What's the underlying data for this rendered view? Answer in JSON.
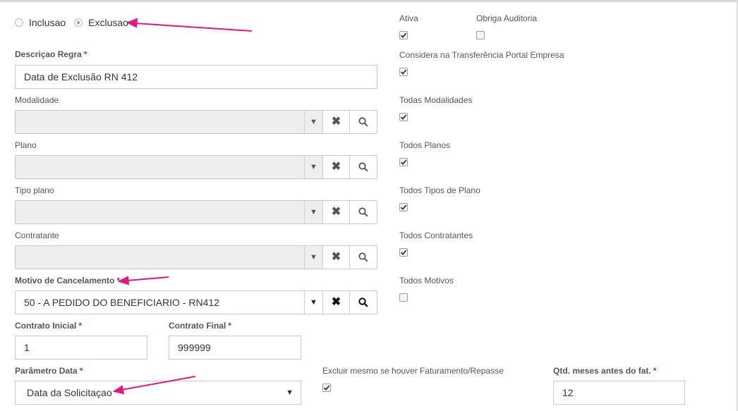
{
  "tipo": {
    "options": [
      {
        "label": "Inclusao",
        "checked": false
      },
      {
        "label": "Exclusao",
        "checked": true
      }
    ]
  },
  "descricao": {
    "label": "Descriçao Regra",
    "required": "*",
    "value": "Data de Exclusão RN 412"
  },
  "modalidade": {
    "label": "Modalidade",
    "value": ""
  },
  "plano": {
    "label": "Plano",
    "value": ""
  },
  "tipo_plano": {
    "label": "Tipo plano",
    "value": ""
  },
  "contratante": {
    "label": "Contratante",
    "value": ""
  },
  "motivo": {
    "label": "Motivo de Cancelamento",
    "required": "*",
    "value": "50 - A PEDIDO DO BENEFICIARIO - RN412"
  },
  "contrato_inicial": {
    "label": "Contrato Inicial",
    "required": "*",
    "value": "1"
  },
  "contrato_final": {
    "label": "Contrato Final",
    "required": "*",
    "value": "999999"
  },
  "parametro_data": {
    "label": "Parâmetro Data",
    "required": "*",
    "value": "Data da Solicitaçao"
  },
  "excluir_faturamento": {
    "label": "Excluir mesmo se houver Faturamento/Repasse",
    "checked": true
  },
  "qtd_meses": {
    "label": "Qtd. meses antes do fat.",
    "required": "*",
    "value": "12"
  },
  "checks": {
    "ativa": {
      "label": "Ativa",
      "checked": true
    },
    "obriga_auditoria": {
      "label": "Obriga Auditoria",
      "checked": false
    },
    "considera_transferencia": {
      "label": "Considera na Transferência Portal Empresa",
      "checked": true
    },
    "todas_modalidades": {
      "label": "Todas Modalidades",
      "checked": true
    },
    "todos_planos": {
      "label": "Todos Planos",
      "checked": true
    },
    "todos_tipos_plano": {
      "label": "Todos Tipos de Plano",
      "checked": true
    },
    "todos_contratantes": {
      "label": "Todos Contratantes",
      "checked": true
    },
    "todos_motivos": {
      "label": "Todos Motivos",
      "checked": false
    }
  },
  "icons": {
    "clear": "times-icon",
    "search": "search-icon",
    "caret": "caret-down-icon"
  },
  "colors": {
    "annotation_arrow": "#e8177d",
    "required": "#c9302c",
    "disabled_bg": "#eeeeee"
  }
}
